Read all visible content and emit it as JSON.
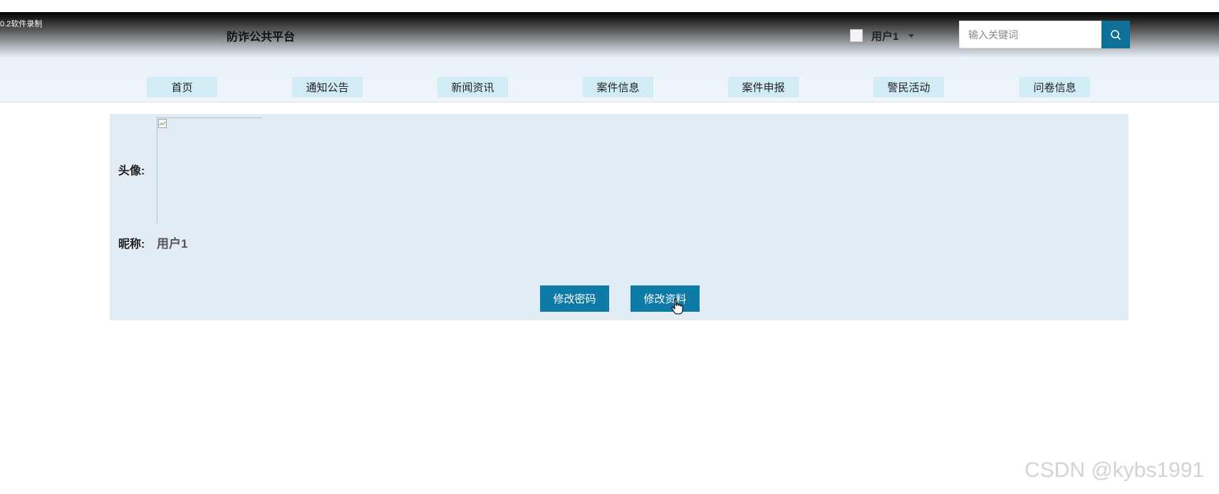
{
  "recorder_tag": "0.2软件录制",
  "header": {
    "site_title": "防诈公共平台",
    "user": {
      "name": "用户1"
    },
    "search": {
      "placeholder": "输入关键词",
      "value": ""
    }
  },
  "nav": {
    "items": [
      {
        "label": "首页"
      },
      {
        "label": "通知公告"
      },
      {
        "label": "新闻资讯"
      },
      {
        "label": "案件信息"
      },
      {
        "label": "案件申报"
      },
      {
        "label": "警民活动"
      },
      {
        "label": "问卷信息"
      }
    ]
  },
  "profile": {
    "avatar_label": "头像:",
    "nickname_label": "昵称:",
    "nickname_value": "用户1",
    "change_password_label": "修改密码",
    "edit_profile_label": "修改资料"
  },
  "watermark": "CSDN @kybs1991",
  "colors": {
    "accent": "#0e7ba6",
    "nav_item_bg": "#d2ecf5",
    "panel_bg": "#e2ecf4"
  },
  "icons": {
    "search": "search-icon",
    "user_dropdown": "caret-down-icon",
    "broken_image": "broken-image-icon",
    "cursor": "hand-pointer-icon"
  }
}
